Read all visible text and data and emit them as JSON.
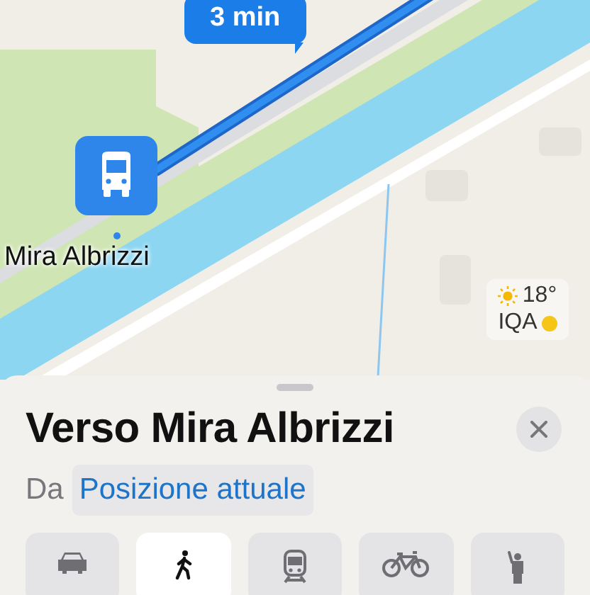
{
  "map": {
    "kind": "picture",
    "route_time": "3 min",
    "stop_name": "Mira Albrizzi",
    "weather": {
      "temperature": "18°",
      "air_quality": {
        "label": "IQA",
        "color": "#f5c518"
      }
    }
  },
  "sheet": {
    "title": "Verso Mira Albrizzi",
    "from_label": "Da",
    "from_value": "Posizione attuale",
    "modes": [
      {
        "kind": "car",
        "selected": false
      },
      {
        "kind": "walk",
        "selected": true
      },
      {
        "kind": "transit",
        "selected": false
      },
      {
        "kind": "bike",
        "selected": false
      },
      {
        "kind": "rideshare",
        "selected": false
      }
    ]
  }
}
